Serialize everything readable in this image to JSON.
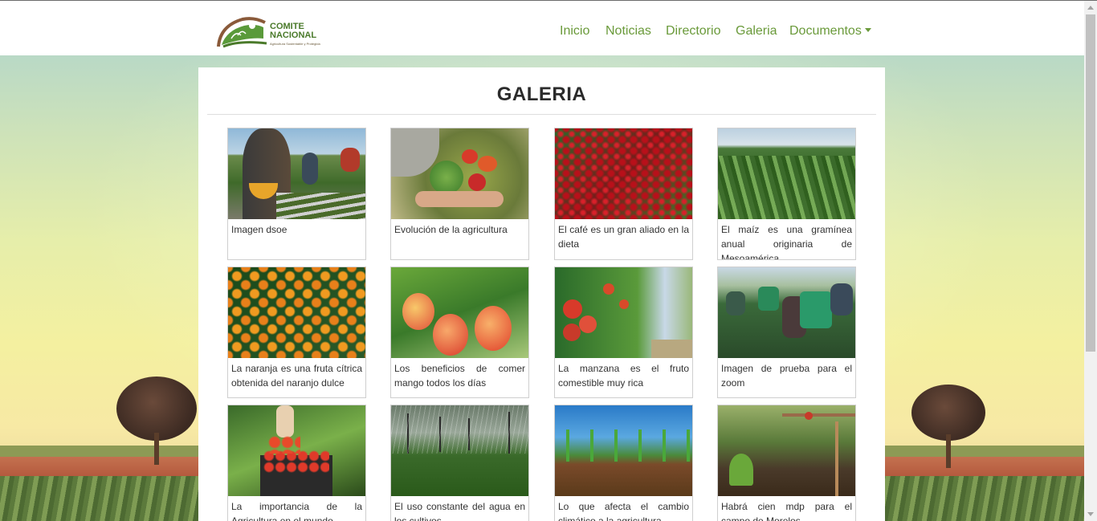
{
  "brand": {
    "name_line1": "COMITE",
    "name_line2": "NACIONAL",
    "tagline": "Agricultura Sustentable y Protegida"
  },
  "nav": {
    "items": [
      {
        "label": "Inicio"
      },
      {
        "label": "Noticias"
      },
      {
        "label": "Directorio"
      },
      {
        "label": "Galeria"
      },
      {
        "label": "Documentos"
      }
    ]
  },
  "page": {
    "title": "GALERIA"
  },
  "gallery": [
    {
      "caption": "Imagen dsoe",
      "image": "farm-workers-harvest"
    },
    {
      "caption": "Evolución de la agricultura",
      "image": "hands-vegetable-basket"
    },
    {
      "caption": "El café es un gran aliado en la dieta",
      "image": "red-coffee-cherries"
    },
    {
      "caption": "El maíz es una gramínea anual originaria de Mesoamérica",
      "image": "corn-field"
    },
    {
      "caption": "La naranja es una fruta cítrica obtenida del naranjo dulce",
      "image": "orange-tree"
    },
    {
      "caption": "Los beneficios de comer mango todos los días",
      "image": "mangoes-on-tree"
    },
    {
      "caption": "La manzana es el fruto comestible muy rica",
      "image": "apple-orchard"
    },
    {
      "caption": "Imagen de prueba para el zoom",
      "image": "workers-spraying-crops"
    },
    {
      "caption": "La importancia de la Agricultura en el mundo",
      "image": "tomato-harvest-crate"
    },
    {
      "caption": "El uso constante del agua en los cultivos",
      "image": "sprinkler-irrigation"
    },
    {
      "caption": "Lo que afecta el cambio climático a la agricultura",
      "image": "corn-seedlings-soil"
    },
    {
      "caption": "Habrá cien mdp para el campo de Morelos",
      "image": "drip-irrigation-seedling"
    }
  ],
  "colors": {
    "nav_link": "#6a9a3a",
    "brand_green": "#4a7a2a",
    "title": "#2b2b2b"
  }
}
